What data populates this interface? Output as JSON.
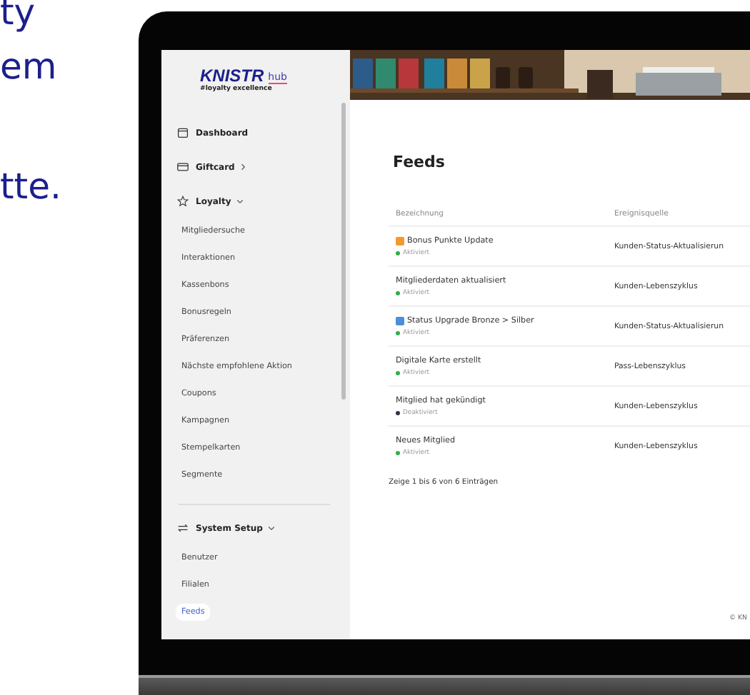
{
  "marketing_text": [
    "ty",
    "em",
    "tte."
  ],
  "app": {
    "logo": {
      "brand": "KNISTR",
      "product": "hub",
      "tagline": "#loyalty excellence"
    },
    "sidebar": {
      "groups": [
        {
          "label": "Dashboard"
        },
        {
          "label": "Giftcard",
          "expanded": false
        },
        {
          "label": "Loyalty",
          "expanded": true,
          "children": [
            {
              "label": "Mitgliedersuche",
              "selected": false
            },
            {
              "label": "Interaktionen",
              "selected": false
            },
            {
              "label": "Kassenbons",
              "selected": false
            },
            {
              "label": "Bonusregeln",
              "selected": false
            },
            {
              "label": "Präferenzen",
              "selected": false
            },
            {
              "label": "Nächste empfohlene Aktion",
              "selected": false
            },
            {
              "label": "Coupons",
              "selected": false
            },
            {
              "label": "Kampagnen",
              "selected": false
            },
            {
              "label": "Stempelkarten",
              "selected": false
            },
            {
              "label": "Segmente",
              "selected": false
            }
          ]
        },
        {
          "label": "System Setup",
          "expanded": true,
          "children": [
            {
              "label": "Benutzer",
              "selected": false
            },
            {
              "label": "Filialen",
              "selected": false
            },
            {
              "label": "Feeds",
              "selected": true
            }
          ]
        }
      ]
    },
    "page_title": "Feeds",
    "table": {
      "columns": [
        "Bezeichnung",
        "Ereignisquelle"
      ],
      "rows": [
        {
          "name": "Bonus Punkte Update",
          "color": "#f29a2e",
          "status": "Aktiviert",
          "active": true,
          "source": "Kunden-Status-Aktualisierun"
        },
        {
          "name": "Mitgliederdaten aktualisiert",
          "status": "Aktiviert",
          "active": true,
          "source": "Kunden-Lebenszyklus"
        },
        {
          "name": "Status Upgrade Bronze > Silber",
          "color": "#4a8fd9",
          "status": "Aktiviert",
          "active": true,
          "source": "Kunden-Status-Aktualisierun"
        },
        {
          "name": "Digitale Karte erstellt",
          "status": "Aktiviert",
          "active": true,
          "source": "Pass-Lebenszyklus"
        },
        {
          "name": "Mitglied hat gekündigt",
          "status": "Deaktiviert",
          "active": false,
          "source": "Kunden-Lebenszyklus"
        },
        {
          "name": "Neues Mitglied",
          "status": "Aktiviert",
          "active": true,
          "source": "Kunden-Lebenszyklus"
        }
      ]
    },
    "table_footer": "Zeige 1 bis 6 von 6 Einträgen",
    "copyright": "© KN"
  }
}
